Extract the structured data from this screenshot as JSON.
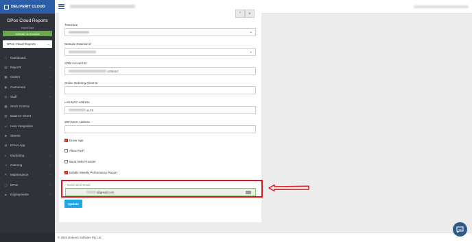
{
  "brand": {
    "name": "DELIVERIT CLOUD"
  },
  "sidebar": {
    "title": "DPos Cloud Reports",
    "import_label": "Import Data",
    "activate_label": "Activate on Account",
    "store_select": "DPos Cloud Reports",
    "items": [
      {
        "label": "Dashboard",
        "icon": "home-icon",
        "arrow": false
      },
      {
        "label": "Reports",
        "icon": "chart-icon",
        "arrow": true
      },
      {
        "label": "Orders",
        "icon": "cart-icon",
        "arrow": true
      },
      {
        "label": "Customers",
        "icon": "users-icon",
        "arrow": true
      },
      {
        "label": "Staff",
        "icon": "staff-icon",
        "arrow": true
      },
      {
        "label": "Stock Control",
        "icon": "box-icon",
        "arrow": false
      },
      {
        "label": "Balance Sheet",
        "icon": "sheet-icon",
        "arrow": false
      },
      {
        "label": "Hero Integration",
        "icon": "link-icon",
        "arrow": false
      },
      {
        "label": "Streets",
        "icon": "map-icon",
        "arrow": false
      },
      {
        "label": "Driver App",
        "icon": "car-icon",
        "arrow": false
      },
      {
        "label": "Marketing",
        "icon": "megaphone-icon",
        "arrow": true
      },
      {
        "label": "Catering",
        "icon": "catering-icon",
        "arrow": true
      },
      {
        "label": "Maintenance",
        "icon": "wrench-icon",
        "arrow": true
      },
      {
        "label": "DPos",
        "icon": "pos-icon",
        "arrow": true
      },
      {
        "label": "Deployments",
        "icon": "rocket-icon",
        "arrow": true
      }
    ]
  },
  "form": {
    "timezone_label": "Timezone",
    "netsuite_label": "Netsuite External Id",
    "crm_label": "CRM Account ID",
    "crm_value_suffix": "c6f3e0cf",
    "online_ordering_label": "Online Ordering Client Id",
    "lan_mac_label": "LAN MAC Address",
    "lan_mac_suffix": "a1F8",
    "wifi_mac_label": "WiFi MAC Address",
    "checkboxes": [
      {
        "label": "Driver App",
        "checked": true
      },
      {
        "label": "Allow Push",
        "checked": false
      },
      {
        "label": "Burst SMS Provider",
        "checked": false
      },
      {
        "label": "Enable Weekly Performance Report",
        "checked": true
      }
    ],
    "nominated_email_label": "Nominated Email",
    "nominated_email_value": "@gmail.com",
    "update_label": "Update"
  },
  "footer": {
    "text": "© 2025 Deliverit Software Pty Ltd"
  },
  "colors": {
    "brand_blue": "#2c5ea8",
    "sidebar_bg": "#2f3238",
    "highlight_red": "#e0151f",
    "update_blue": "#1ea7e0",
    "success_green": "#6aa84f"
  }
}
